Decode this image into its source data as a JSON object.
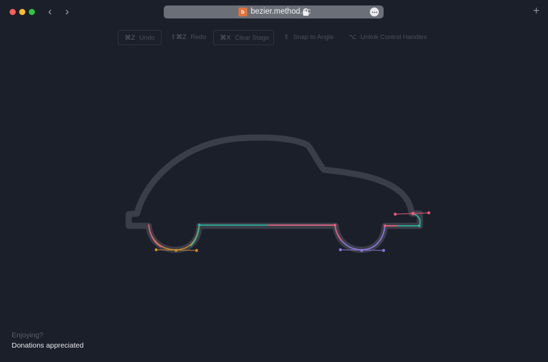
{
  "browser": {
    "url": "bezier.method.ac",
    "site_icon_text": "b",
    "traffic_colors": [
      "#fe5f57",
      "#febc2e",
      "#28c840"
    ],
    "back_glyph": "‹",
    "forward_glyph": "›",
    "newtab_glyph": "+",
    "icons": [
      "lock-icon",
      "more-icon",
      "new-tab-icon",
      "back-icon",
      "forward-icon"
    ]
  },
  "toolbar": {
    "undo": {
      "key": "⌘Z",
      "label": "Undo"
    },
    "redo": {
      "key": "⇧⌘Z",
      "label": "Redo"
    },
    "clear": {
      "key": "⌘X",
      "label": "Clear Stage"
    },
    "snap": {
      "key": "⇧",
      "label": "Snap to Angle"
    },
    "unlink": {
      "key": "⌥",
      "label": "Unlink Control Handles"
    }
  },
  "stage": {
    "guide_color": "#3a3e49",
    "segment_colors": {
      "teal": "#2cb19a",
      "pink": "#e85a7a",
      "purple": "#8c74d8",
      "orange": "#c9882a"
    }
  },
  "footer": {
    "line1": "Enjoying?",
    "line2": "Donations appreciated"
  }
}
